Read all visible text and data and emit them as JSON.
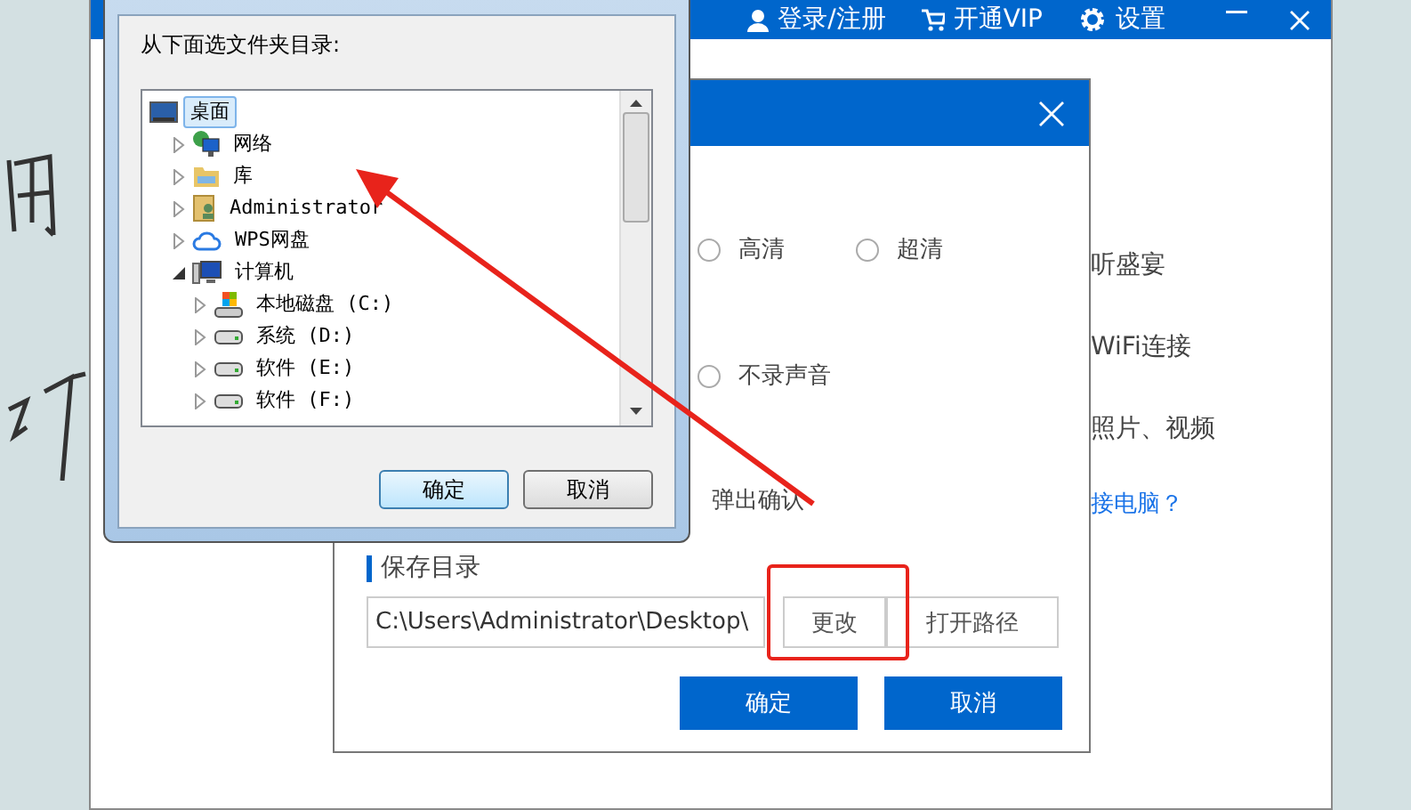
{
  "main_window": {
    "top_bar": {
      "login": "登录/注册",
      "vip": "开通VIP",
      "settings": "设置"
    },
    "feature_texts": [
      {
        "text": "听盛宴",
        "kind": "plain"
      },
      {
        "text": "WiFi连接",
        "kind": "plain"
      },
      {
        "text": "照片、视频",
        "kind": "plain"
      },
      {
        "text": "接电脑？",
        "kind": "link"
      }
    ]
  },
  "settings_dialog": {
    "quality_options": [
      {
        "label": "高清",
        "selected": false
      },
      {
        "label": "超清",
        "selected": false
      }
    ],
    "audio_options": [
      {
        "label": "不录声音",
        "selected": false
      }
    ],
    "confirm_text": "弹出确认",
    "save_section": {
      "title": "保存目录",
      "path": "C:\\Users\\Administrator\\Desktop\\",
      "change_button": "更改",
      "open_button": "打开路径"
    },
    "buttons": [
      "确定",
      "取消"
    ]
  },
  "folder_dialog": {
    "prompt": "从下面选文件夹目录:",
    "tree": [
      {
        "label": "桌面",
        "kind": "desktop",
        "selected": true,
        "children": [
          {
            "label": "网络",
            "kind": "network",
            "selected": false,
            "expanded": false
          },
          {
            "label": "库",
            "kind": "library",
            "selected": false,
            "expanded": false
          },
          {
            "label": "Administrator",
            "kind": "user-folder",
            "selected": false,
            "expanded": false
          },
          {
            "label": "WPS网盘",
            "kind": "cloud",
            "selected": false,
            "expanded": false
          },
          {
            "label": "计算机",
            "kind": "computer",
            "selected": false,
            "expanded": true,
            "children": [
              {
                "label": "本地磁盘 (C:)",
                "kind": "system-drive",
                "selected": false,
                "expanded": false
              },
              {
                "label": "系统 (D:)",
                "kind": "drive",
                "selected": false,
                "expanded": false
              },
              {
                "label": "软件 (E:)",
                "kind": "drive",
                "selected": false,
                "expanded": false
              },
              {
                "label": "软件 (F:)",
                "kind": "drive",
                "selected": false,
                "expanded": false
              }
            ]
          }
        ]
      }
    ],
    "buttons": [
      {
        "label": "确定",
        "default": true
      },
      {
        "label": "取消",
        "default": false
      }
    ]
  }
}
